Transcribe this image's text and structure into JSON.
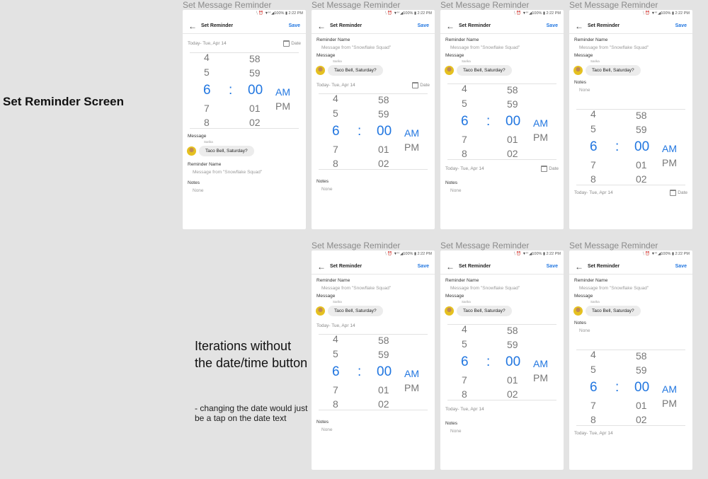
{
  "side_title": "Set Reminder Screen",
  "iterations": {
    "title": "Iterations without the date/time button",
    "note": "- changing the date would just be a tap on the date text"
  },
  "mock": {
    "label": "Set Message Reminder",
    "status": "⧹ ⏰ ▼ᴴ ◢100% ▮ 2:22 PM",
    "title": "Set Reminder",
    "save": "Save",
    "back_icon": "arrow-left-icon",
    "date_icon": "calendar-icon",
    "date_text": "Today- Tue, Apr 14",
    "date_button": "Date",
    "message_header": "Message",
    "sender": "Sarika",
    "message_text": "Taco Bell, Saturday?",
    "reminder_header": "Reminder Name",
    "reminder_placeholder": "Message from \"Snowflake Squad\"",
    "notes_header": "Notes",
    "notes_value": "None",
    "picker": {
      "hours": [
        "4",
        "5",
        "6",
        "7",
        "8"
      ],
      "minutes": [
        "58",
        "59",
        "00",
        "01",
        "02"
      ],
      "separator": ":",
      "am": "AM",
      "pm": "PM"
    }
  }
}
